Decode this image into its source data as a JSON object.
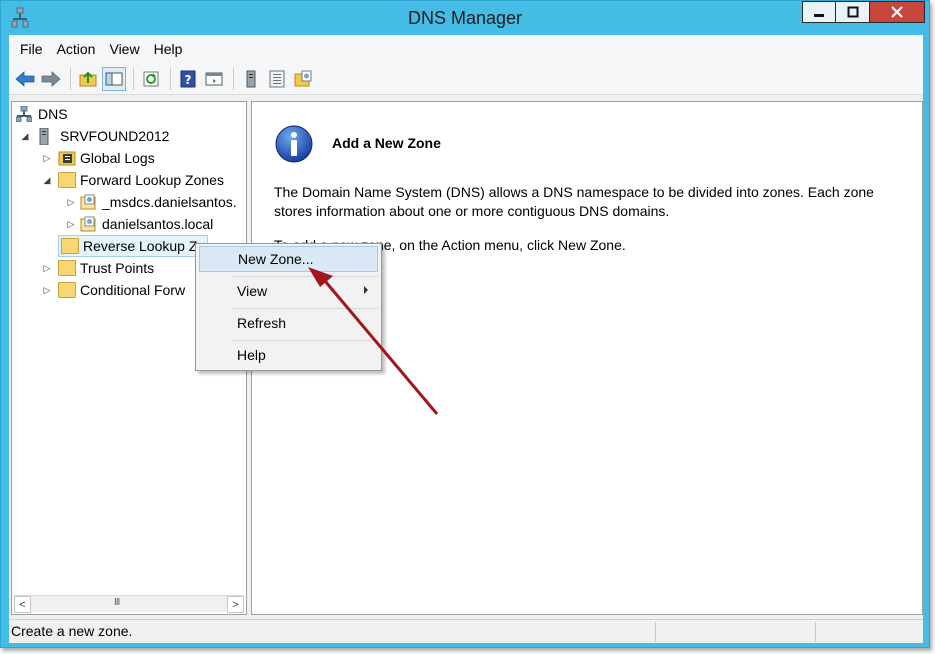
{
  "window": {
    "title": "DNS Manager",
    "accent_color": "#45bce6",
    "close_color": "#c7463c"
  },
  "menubar": {
    "items": [
      "File",
      "Action",
      "View",
      "Help"
    ]
  },
  "toolbar": {
    "icons": [
      "back-arrow-icon",
      "forward-arrow-icon",
      "up-folder-icon",
      "show-hide-tree-icon",
      "refresh-icon",
      "help-icon",
      "console-icon",
      "server-icon",
      "list-icon",
      "zone-icon"
    ]
  },
  "tree": {
    "root": "DNS",
    "server": "SRVFOUND2012",
    "items": {
      "global_logs": "Global Logs",
      "forward_lookup": "Forward Lookup Zones",
      "msdcs": "_msdcs.danielsantos.",
      "local_zone": "danielsantos.local",
      "reverse_lookup": "Reverse Lookup Zo",
      "trust_points": "Trust Points",
      "conditional": "Conditional Forw"
    }
  },
  "detail": {
    "heading": "Add a New Zone",
    "description": "The Domain Name System (DNS) allows a DNS namespace to be divided into zones. Each zone stores information about one or more contiguous DNS domains.",
    "hint": "To add a new zone, on the Action menu, click New Zone."
  },
  "context_menu": {
    "new_zone": "New Zone...",
    "view": "View",
    "refresh": "Refresh",
    "help": "Help"
  },
  "status": {
    "text": "Create a new zone."
  },
  "scrollbar": {
    "grip": "III",
    "left": "<",
    "right": ">"
  },
  "annotation": {
    "arrow_color": "#a0161c"
  }
}
